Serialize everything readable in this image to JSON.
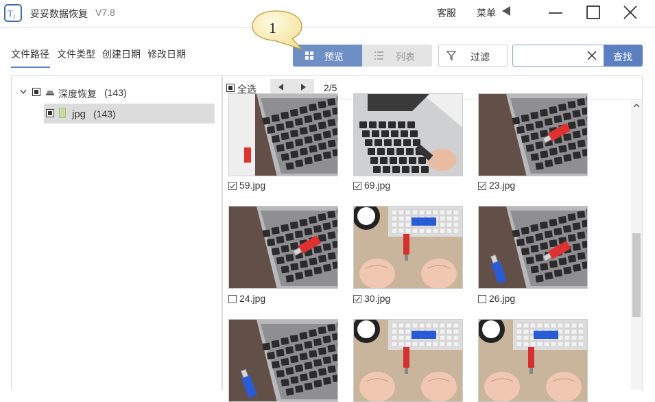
{
  "app": {
    "title": "妥妥数据恢复",
    "version": "V7.8"
  },
  "titlebar": {
    "service": "客服",
    "menu": "菜单"
  },
  "tabs": [
    "文件路径",
    "文件类型",
    "创建日期",
    "修改日期"
  ],
  "view": {
    "preview": "预览",
    "list": "列表",
    "filter": "过滤",
    "find": "查找",
    "search_value": ""
  },
  "callout": {
    "number": "1"
  },
  "tree": {
    "root": {
      "label": "深度恢复",
      "count": "(143)"
    },
    "child": {
      "label": "jpg",
      "count": "(143)"
    }
  },
  "grid": {
    "select_all": "全选",
    "page": "2/5",
    "items": [
      {
        "name": "59.jpg",
        "checked": true
      },
      {
        "name": "69.jpg",
        "checked": true
      },
      {
        "name": "23.jpg",
        "checked": true
      },
      {
        "name": "24.jpg",
        "checked": false
      },
      {
        "name": "30.jpg",
        "checked": true
      },
      {
        "name": "26.jpg",
        "checked": false
      },
      {
        "name": "",
        "checked": false
      },
      {
        "name": "",
        "checked": false
      },
      {
        "name": "",
        "checked": false
      }
    ]
  },
  "colors": {
    "accent": "#5b7fc0",
    "preview_active": "#6e8ec6",
    "usb_red": "#e0302f",
    "usb_blue": "#2a5bd7"
  }
}
